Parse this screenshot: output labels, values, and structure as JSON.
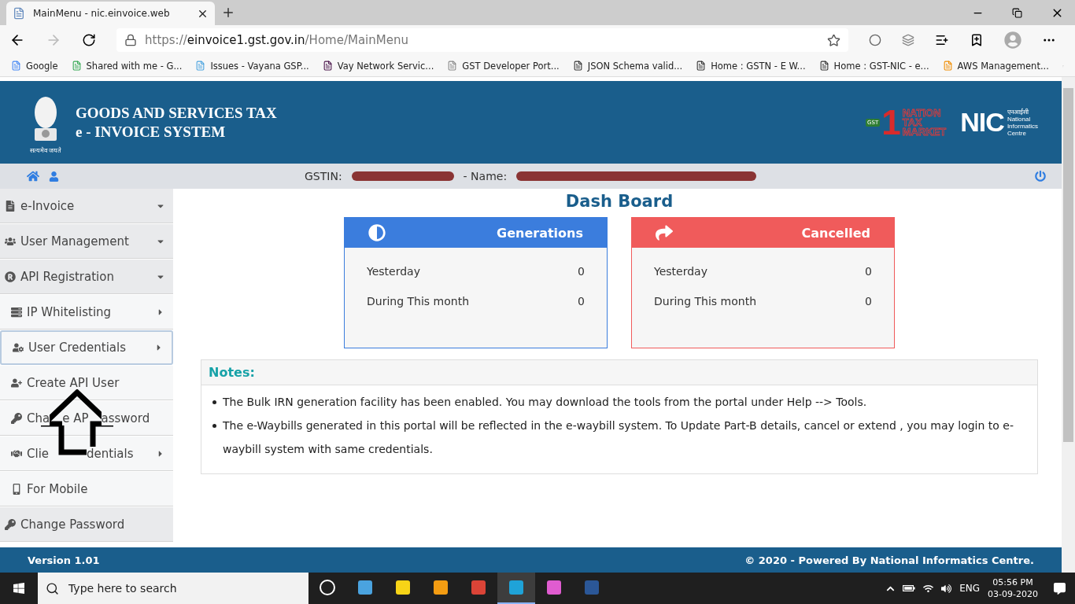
{
  "browser": {
    "tab": {
      "title": "MainMenu - nic.einvoice.web",
      "selected": true
    },
    "url": {
      "scheme": "https://",
      "host": "einvoice1.gst.gov.in",
      "path": "/Home/MainMenu"
    },
    "bookmarks": [
      "Google",
      "Shared with me - G...",
      "Issues - Vayana GSP...",
      "Vay Network Servic...",
      "GST Developer Port...",
      "JSON Schema valid...",
      "Home : GSTN - E W...",
      "Home : GST-NIC - e...",
      "AWS Management..."
    ]
  },
  "header": {
    "emblem_motto": "सत्यमेव जयते",
    "title_line_1": "GOODS AND SERVICES TAX",
    "title_line_2": "e - INVOICE SYSTEM",
    "gst_logo": {
      "numeral": "1",
      "gst": "GST",
      "words": [
        "NATION",
        "TAX",
        "MARKET"
      ]
    },
    "nic_logo": {
      "mark": "NIC",
      "hindi": "एनआईसी",
      "words": [
        "National",
        "Informatics",
        "Centre"
      ]
    }
  },
  "user_bar": {
    "gstin_label": "GSTIN:",
    "name_label": "- Name:"
  },
  "sidebar": {
    "items": [
      {
        "label": "e-Invoice",
        "kind": "menu",
        "selected": false
      },
      {
        "label": "User Management",
        "kind": "menu",
        "selected": false
      },
      {
        "label": "API Registration",
        "kind": "menu",
        "selected": false,
        "children": [
          {
            "label": "IP Whitelisting",
            "kind": "submenu",
            "selected": false
          },
          {
            "label": "User Credentials",
            "kind": "submenu",
            "selected": true
          },
          {
            "label": "Create API User",
            "kind": "link",
            "selected": false
          },
          {
            "label_parts": [
              "Cha",
              "e AP",
              "assword"
            ],
            "kind": "link",
            "selected": false
          },
          {
            "label_parts": [
              "Clie",
              "dentials"
            ],
            "kind": "submenu",
            "selected": false
          },
          {
            "label": "For Mobile",
            "kind": "link",
            "selected": false
          }
        ]
      },
      {
        "label": "Change Password",
        "kind": "single",
        "selected": false
      }
    ]
  },
  "dashboard": {
    "title": "Dash Board",
    "cards": [
      {
        "kind": "generations",
        "title": "Generations",
        "color": "#3b7ddd",
        "rows": [
          {
            "label": "Yesterday",
            "value": "0"
          },
          {
            "label": "During This month",
            "value": "0"
          }
        ]
      },
      {
        "kind": "cancelled",
        "title": "Cancelled",
        "color": "#f05b5b",
        "rows": [
          {
            "label": "Yesterday",
            "value": "0"
          },
          {
            "label": "During This month",
            "value": "0"
          }
        ]
      }
    ],
    "notes": {
      "title": "Notes:",
      "items": [
        "The Bulk IRN generation facility has been enabled. You may download the tools from the portal under Help --> Tools.",
        "The e-Waybills generated in this portal will be reflected in the e-waybill system. To Update Part-B details, cancel or extend , you may login to e-waybill system with same credentials."
      ]
    }
  },
  "footer": {
    "version": "Version 1.01",
    "credit": "© 2020 - Powered By National Informatics Centre."
  },
  "taskbar": {
    "search_placeholder": "Type here to search",
    "apps": [
      {
        "selected": false
      },
      {
        "selected": false
      },
      {
        "selected": false
      },
      {
        "selected": false
      },
      {
        "selected": false
      },
      {
        "selected": true
      },
      {
        "selected": false
      },
      {
        "selected": false
      }
    ],
    "language": "ENG",
    "time": "05:56 PM",
    "date": "03-09-2020"
  }
}
